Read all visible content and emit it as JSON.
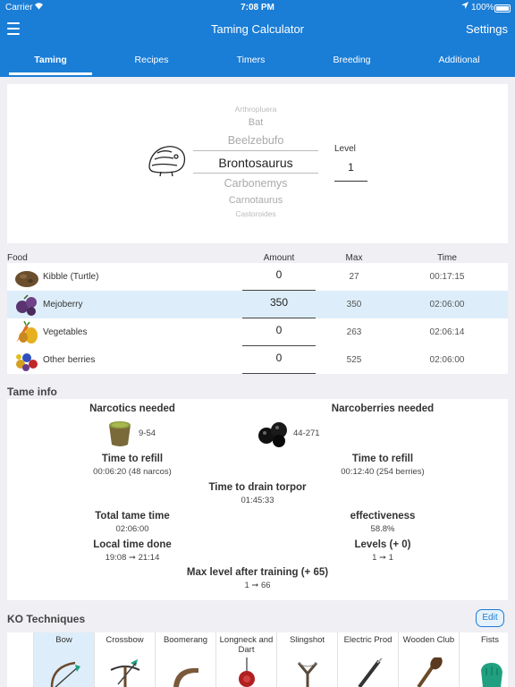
{
  "status": {
    "carrier": "Carrier",
    "time": "7:08 PM",
    "battery": "100%"
  },
  "nav": {
    "title": "Taming Calculator",
    "settings_label": "Settings"
  },
  "tabs": [
    {
      "label": "Taming"
    },
    {
      "label": "Recipes"
    },
    {
      "label": "Timers"
    },
    {
      "label": "Breeding"
    },
    {
      "label": "Additional"
    }
  ],
  "creature_picker": {
    "items": [
      "Arthropluera",
      "Bat",
      "Beelzebufo",
      "Brontosaurus",
      "Carbonemys",
      "Carnotaurus",
      "Castoroides"
    ],
    "selected": "Brontosaurus"
  },
  "level": {
    "label": "Level",
    "value": "1"
  },
  "food_table": {
    "headers": {
      "food": "Food",
      "amount": "Amount",
      "max": "Max",
      "time": "Time"
    },
    "rows": [
      {
        "name": "Kibble (Turtle)",
        "amount": "0",
        "max": "27",
        "time": "00:17:15",
        "icon": "kibble-icon"
      },
      {
        "name": "Mejoberry",
        "amount": "350",
        "max": "350",
        "time": "02:06:00",
        "icon": "mejoberry-icon",
        "selected": true
      },
      {
        "name": "Vegetables",
        "amount": "0",
        "max": "263",
        "time": "02:06:14",
        "icon": "vegetables-icon"
      },
      {
        "name": "Other berries",
        "amount": "0",
        "max": "525",
        "time": "02:06:00",
        "icon": "berries-icon"
      }
    ]
  },
  "tame_info": {
    "title": "Tame info",
    "narcotics_label": "Narcotics needed",
    "narcotics_value": "9-54",
    "narcoberries_label": "Narcoberries needed",
    "narcoberries_value": "44-271",
    "refill_left_label": "Time to refill",
    "refill_left_value": "00:06:20 (48 narcos)",
    "refill_right_label": "Time to refill",
    "refill_right_value": "00:12:40 (254 berries)",
    "drain_label": "Time to drain torpor",
    "drain_value": "01:45:33",
    "total_label": "Total tame time",
    "total_value": "02:06:00",
    "effectiveness_label": "effectiveness",
    "effectiveness_value": "58.8%",
    "local_label": "Local time done",
    "local_value": "19:08 ➞ 21:14",
    "levels_label": "Levels (+ 0)",
    "levels_value": "1 ➞ 1",
    "maxlevel_label": "Max level after training (+ 65)",
    "maxlevel_value": "1 ➞ 66"
  },
  "ko": {
    "title": "KO Techniques",
    "edit_label": "Edit",
    "items": [
      {
        "label": "Bow",
        "selected": true,
        "icon": "bow-icon"
      },
      {
        "label": "Crossbow",
        "icon": "crossbow-icon"
      },
      {
        "label": "Boomerang",
        "icon": "boomerang-icon"
      },
      {
        "label": "Longneck and Dart",
        "icon": "longneck-icon"
      },
      {
        "label": "Slingshot",
        "icon": "slingshot-icon"
      },
      {
        "label": "Electric Prod",
        "icon": "electric-prod-icon"
      },
      {
        "label": "Wooden Club",
        "icon": "wooden-club-icon"
      },
      {
        "label": "Fists",
        "icon": "fist-icon"
      }
    ]
  },
  "colors": {
    "accent": "#1a7dd6",
    "selected_row": "#ddeefa",
    "background": "#efeff4"
  }
}
